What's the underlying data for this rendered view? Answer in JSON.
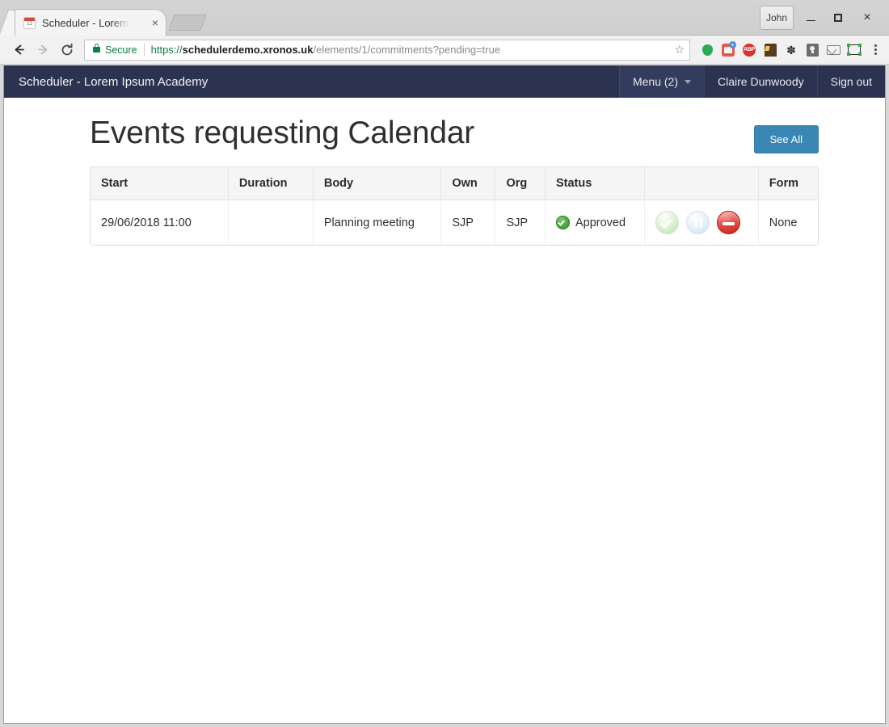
{
  "browser": {
    "tab": {
      "title": "Scheduler - Lorem I",
      "favicon_name": "calendar-favicon",
      "favicon_number": "12",
      "close_label": "×"
    },
    "profile_button_label": "John",
    "window_controls": {
      "minimize": "minimize",
      "maximize": "maximize",
      "close": "×"
    },
    "omnibox": {
      "security_label": "Secure",
      "url_scheme": "https://",
      "url_host": "schedulerdemo.xronos.uk",
      "url_path": "/elements/1/commitments?pending=true",
      "bookmark_star": "☆"
    },
    "extensions": [
      {
        "name": "green-dot-icon",
        "label": ""
      },
      {
        "name": "pocket-icon",
        "label": ""
      },
      {
        "name": "adblock-plus-icon",
        "label": "ABP"
      },
      {
        "name": "house-icon",
        "label": ""
      },
      {
        "name": "footprint-icon",
        "label": "✽"
      },
      {
        "name": "lightbulb-icon",
        "label": ""
      },
      {
        "name": "mail-icon",
        "label": ""
      },
      {
        "name": "screenshot-frame-icon",
        "label": ""
      }
    ]
  },
  "app": {
    "brand": "Scheduler - Lorem Ipsum Academy",
    "nav": {
      "menu_label": "Menu (2)",
      "user_label": "Claire Dunwoody",
      "signout_label": "Sign out"
    },
    "accent_color": "#2b3350",
    "button_color": "#3a86b5"
  },
  "page": {
    "title": "Events requesting Calendar",
    "see_all_label": "See All"
  },
  "table": {
    "headers": [
      "Start",
      "Duration",
      "Body",
      "Own",
      "Org",
      "Status",
      "",
      "Form"
    ],
    "rows": [
      {
        "start": "29/06/2018 11:00",
        "duration": "",
        "body": "Planning meeting",
        "own": "SJP",
        "org": "SJP",
        "status": "Approved",
        "status_icon": "green-check-icon",
        "actions": [
          {
            "name": "approve-button",
            "state": "faded"
          },
          {
            "name": "hold-button",
            "state": "faded"
          },
          {
            "name": "deny-button",
            "state": "active"
          }
        ],
        "form": "None"
      }
    ]
  }
}
